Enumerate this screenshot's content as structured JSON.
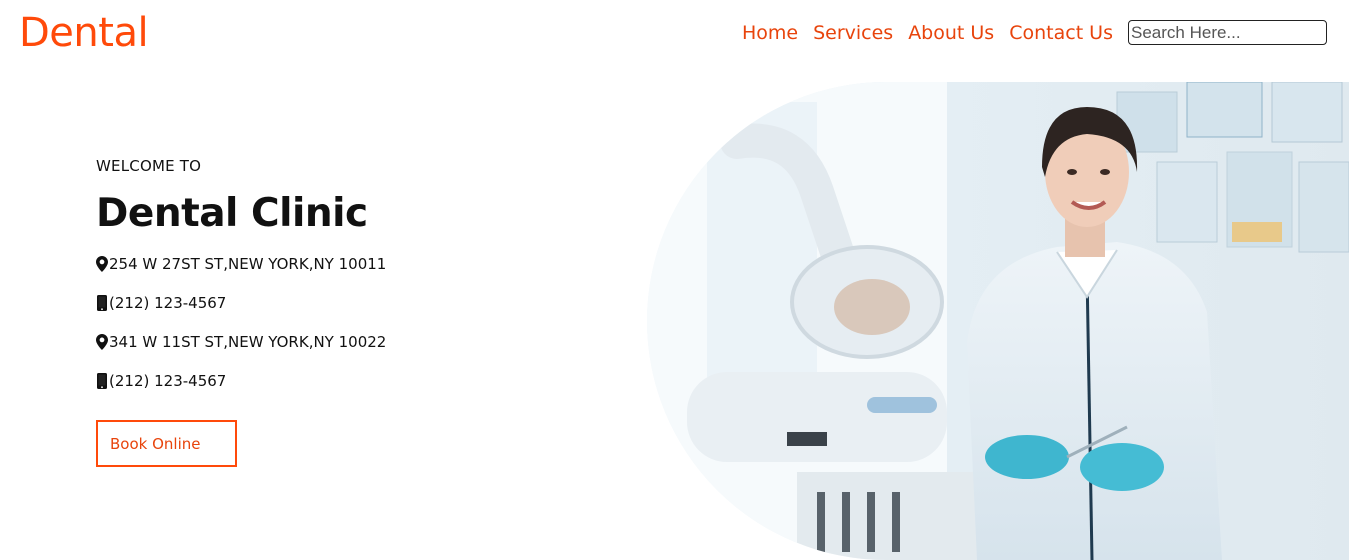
{
  "brand": {
    "logo": "Dental",
    "accent": "#ff4a0a"
  },
  "nav": {
    "items": [
      "Home",
      "Services",
      "About Us",
      "Contact Us"
    ],
    "search_placeholder": "Search Here..."
  },
  "hero": {
    "welcome": "WELCOME TO",
    "title": "Dental Clinic",
    "contacts": [
      {
        "icon": "map-marker-icon",
        "text": "254 W 27ST ST,NEW YORK,NY 10011"
      },
      {
        "icon": "mobile-phone-icon",
        "text": "(212) 123-4567"
      },
      {
        "icon": "map-marker-icon",
        "text": "341 W 11ST ST,NEW YORK,NY 10022"
      },
      {
        "icon": "mobile-phone-icon",
        "text": "(212) 123-4567"
      }
    ],
    "cta": "Book Online"
  }
}
